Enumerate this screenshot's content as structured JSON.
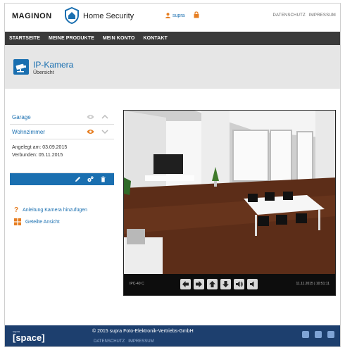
{
  "header": {
    "brand": "MAGINON",
    "brand_sub": "Home Security",
    "user": "supra",
    "links": [
      "DATENSCHUTZ",
      "IMPRESSUM"
    ]
  },
  "nav": {
    "items": [
      "STARTSEITE",
      "MEINE PRODUKTE",
      "MEIN KONTO",
      "KONTAKT"
    ]
  },
  "title": {
    "heading": "IP-Kamera",
    "subheading": "Übersicht"
  },
  "devices": [
    {
      "name": "Garage",
      "active": false
    },
    {
      "name": "Wohnzimmer",
      "active": true
    }
  ],
  "device_detail": {
    "added": "Angelegt am: 03.09.2015",
    "connected": "Verbunden: 05.11.2015"
  },
  "help": {
    "add_camera": "Anleitung Kamera hinzufügen",
    "shared_view": "Geteilte Ansicht"
  },
  "camera": {
    "label": "IPC-40 C",
    "timestamp": "11.11.2015 | 10:51:11"
  },
  "footer": {
    "copyright": "© 2015 supra Foto-Elektronik-Vertriebs-GmbH",
    "links": [
      "DATENSCHUTZ",
      "IMPRESSUM"
    ]
  },
  "colors": {
    "accent": "#1a6fb0",
    "nav_bg": "#3a3a3a",
    "footer_bg": "#1d3f6e",
    "warning": "#e67e22"
  }
}
